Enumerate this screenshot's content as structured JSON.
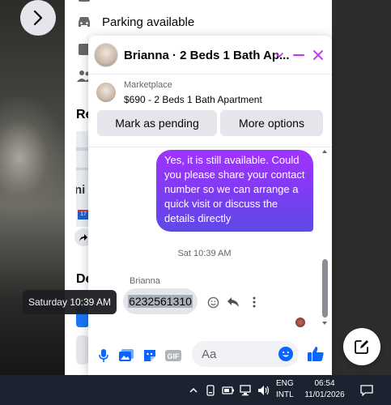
{
  "background_listing": {
    "parking_text": "Parking available",
    "section_re": "Re",
    "section_de": "De",
    "map_text": "ni",
    "highway_badge": "17"
  },
  "chat": {
    "title": "Brianna · 2 Beds 1 Bath Ap...",
    "marketplace_label": "Marketplace",
    "listing_summary": "$690 - 2 Beds 1 Bath Apartment",
    "mark_pending_label": "Mark as pending",
    "more_options_label": "More options",
    "outgoing_message": "Yes, it is still available. Could you please share your contact number so we can arrange a quick visit or discuss the details directly",
    "timestamp": "Sat 10:39 AM",
    "sender_name": "Brianna",
    "incoming_message": "6232561310",
    "composer_placeholder": "Aa"
  },
  "tooltip": {
    "text": "Saturday 10:39 AM"
  },
  "taskbar": {
    "lang_line1": "ENG",
    "lang_line2": "INTL",
    "time": "06:54",
    "date": "11/01/2026"
  },
  "colors": {
    "accent": "#0866ff",
    "outgoing_gradient_top": "#a033ff",
    "outgoing_gradient_bottom": "#5b4be6",
    "header_icon": "#c03df5"
  }
}
